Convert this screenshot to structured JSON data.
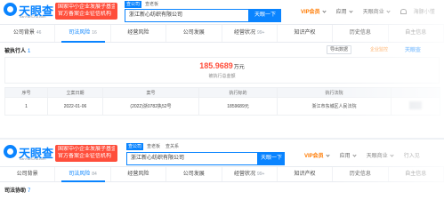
{
  "brand": {
    "name": "天眼查",
    "sub": "TianYanCha.com"
  },
  "promo": {
    "line1": "国家中小企业发展子基金旗下",
    "line2": "官方备案企业征信机构"
  },
  "top": {
    "search_tabs": [
      {
        "label": "查公司",
        "active": true
      },
      {
        "label": "查老板",
        "active": false
      }
    ],
    "search_value": "浙江新心纺织有限公司",
    "search_button": "天眼一下",
    "nav": {
      "vip": "VIP会员",
      "app": "应用",
      "business": "天眼商业",
      "user": "海豚小懂"
    }
  },
  "tabs": [
    {
      "label": "公司背景",
      "count": "46",
      "active": false
    },
    {
      "label": "司法风险",
      "count": "16",
      "active": true
    },
    {
      "label": "经营风险",
      "count": "",
      "active": false
    },
    {
      "label": "公司发展",
      "count": "",
      "active": false
    },
    {
      "label": "经营状况",
      "count": "99+",
      "active": false
    },
    {
      "label": "知识产权",
      "count": "",
      "active": false
    },
    {
      "label": "历史信息",
      "count": "",
      "active": false
    },
    {
      "label": "自主信息",
      "count": "",
      "active": false
    }
  ],
  "section": {
    "title": "被执行人",
    "count": "1",
    "export": "导出数据",
    "monitor": "企业监控",
    "brand_mini": "天眼查"
  },
  "summary": {
    "amount": "185.9689",
    "unit": "万元",
    "label": "被执行总金额"
  },
  "table": {
    "headers": [
      "序号",
      "立案日期",
      "案号",
      "执行标的",
      "执行法院",
      ""
    ],
    "rows": [
      {
        "idx": "1",
        "date": "2022-01-06",
        "case": "(2022)浙0782执52号",
        "amount": "1859689元",
        "court": "浙江市东城区人民法院"
      }
    ]
  },
  "bottom": {
    "search_tabs": [
      {
        "label": "查公司",
        "active": true
      },
      {
        "label": "查老板",
        "active": false
      },
      {
        "label": "查关系",
        "active": false
      }
    ],
    "search_value": "浙江新心纺织有限公司",
    "search_button": "天眼一下",
    "nav": {
      "vip": "VIP会员",
      "app": "应用",
      "business": "天眼商业",
      "extra": "行入见"
    },
    "tabs": [
      {
        "label": "公司背景",
        "count": "",
        "active": false
      },
      {
        "label": "司法风险",
        "count": "84",
        "active": true
      },
      {
        "label": "经营风险",
        "count": "",
        "active": false
      },
      {
        "label": "公司发展",
        "count": "",
        "active": false
      },
      {
        "label": "经营状况",
        "count": "99+",
        "active": false
      },
      {
        "label": "知识产权",
        "count": "",
        "active": false
      },
      {
        "label": "历史信息",
        "count": "",
        "active": false
      },
      {
        "label": "自主信息",
        "count": "",
        "active": false
      }
    ],
    "section_title": "司法协助",
    "section_count": "7"
  }
}
